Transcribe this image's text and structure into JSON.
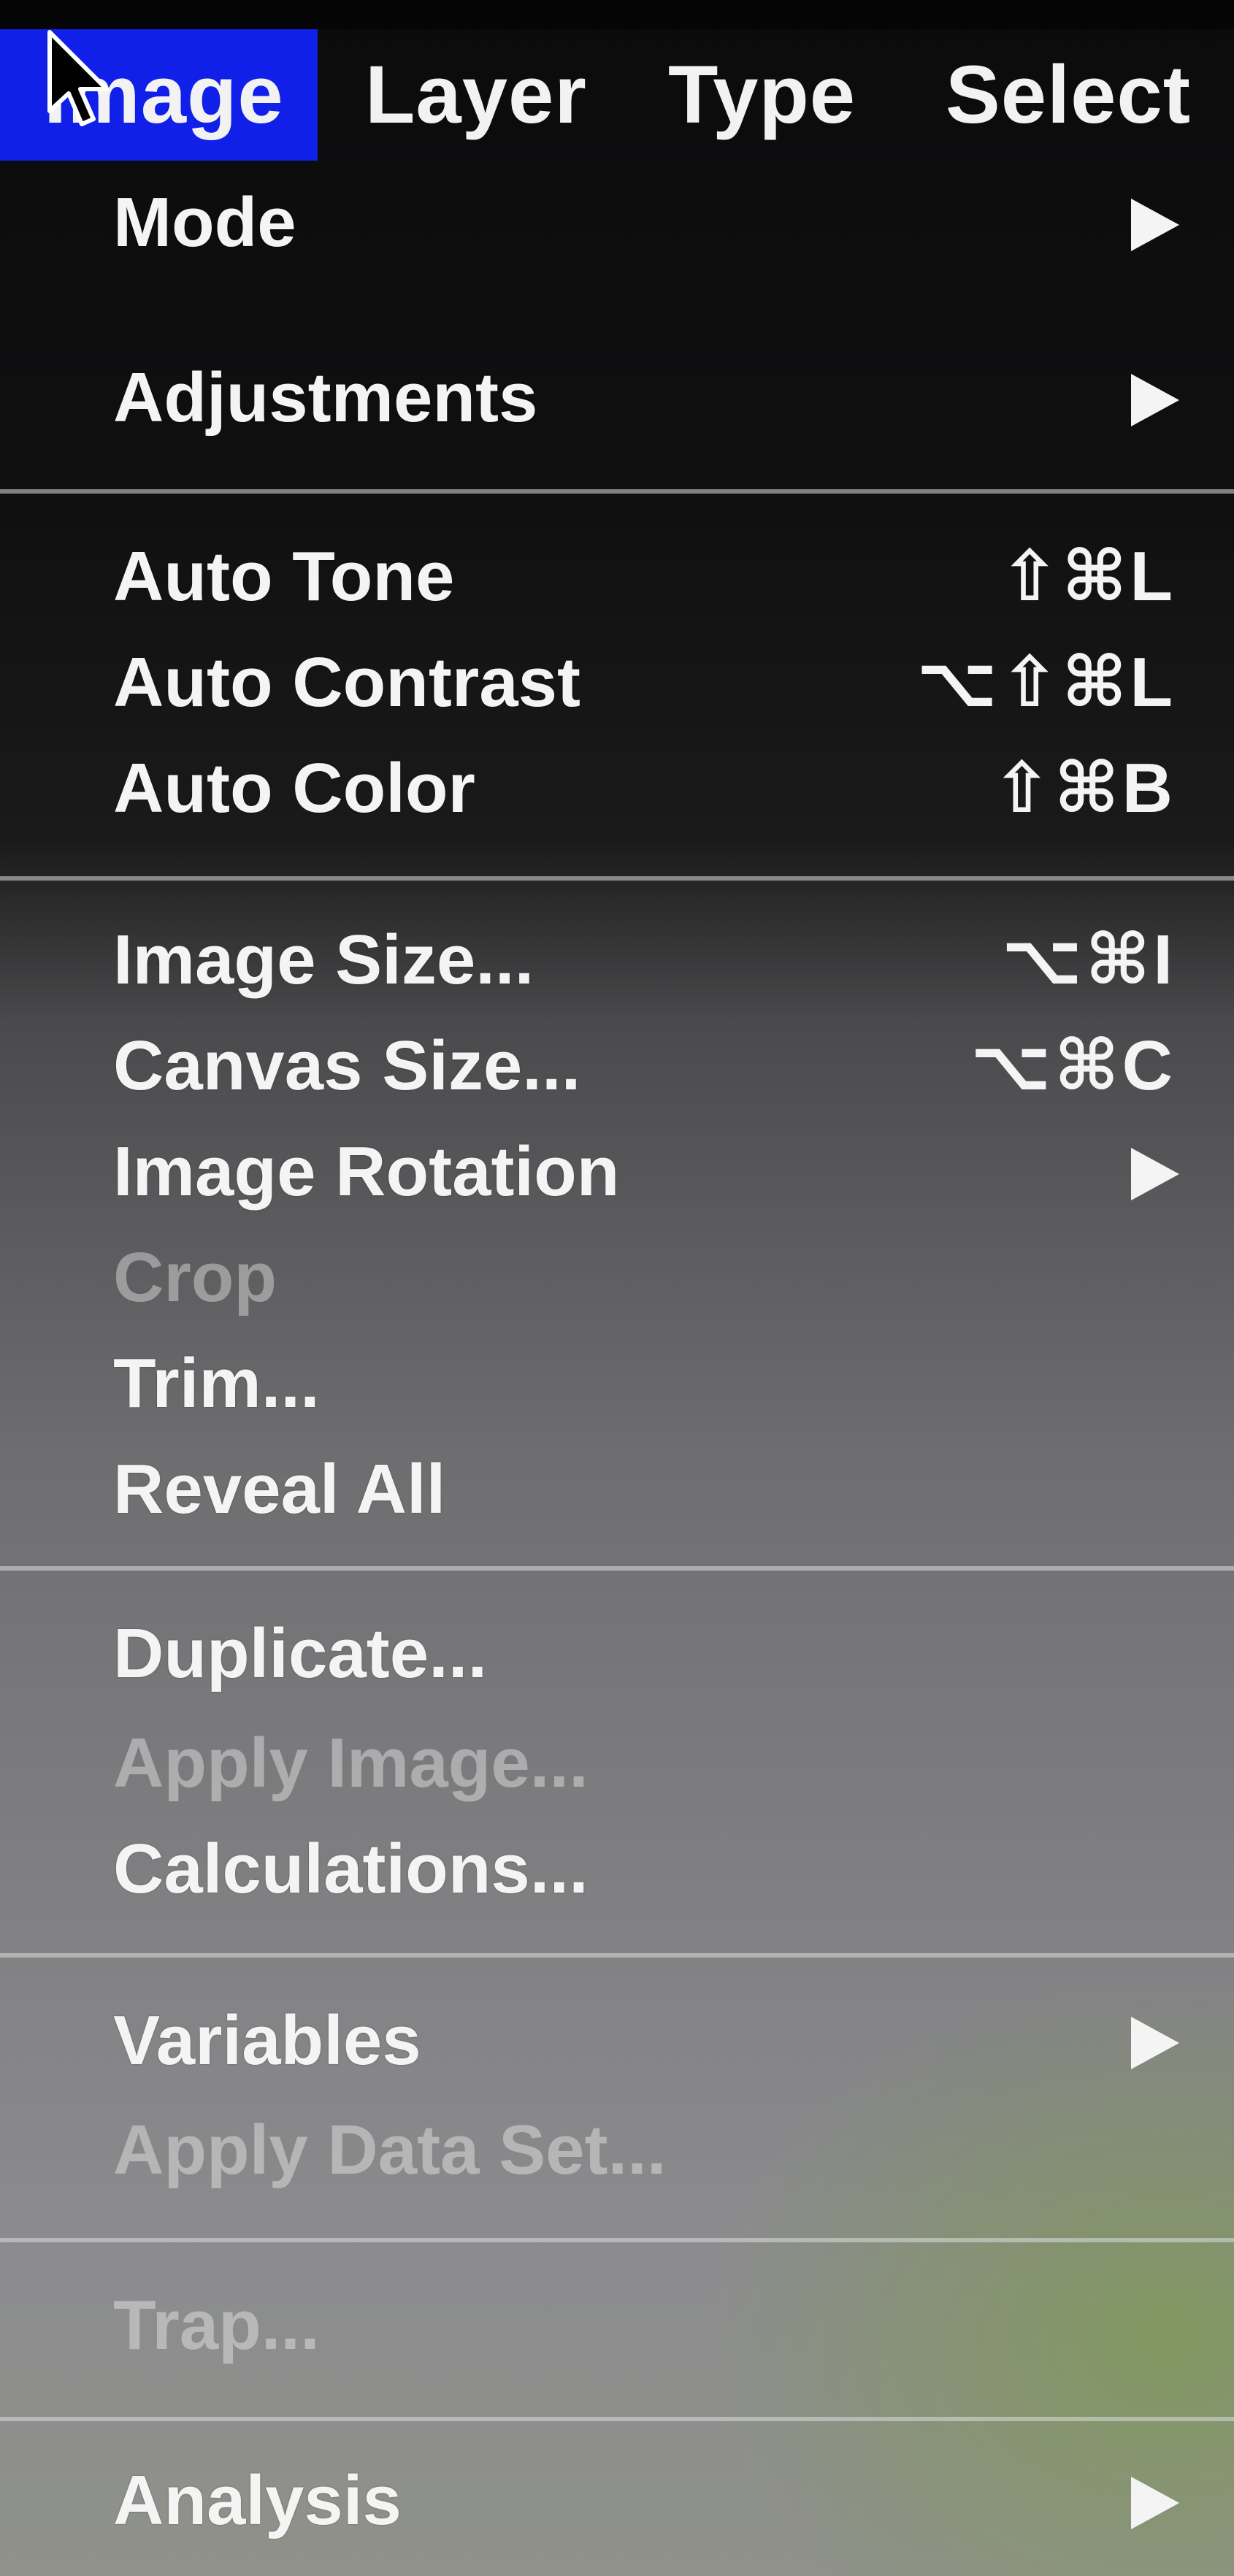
{
  "menubar": {
    "items": [
      {
        "label": "Image"
      },
      {
        "label": "Layer"
      },
      {
        "label": "Type"
      },
      {
        "label": "Select"
      }
    ]
  },
  "menu": {
    "items": [
      {
        "label": "Mode",
        "has_submenu": true
      },
      {
        "label": "Adjustments",
        "has_submenu": true
      },
      {
        "label": "Auto Tone",
        "shortcut": "⇧⌘L"
      },
      {
        "label": "Auto Contrast",
        "shortcut": "⌥⇧⌘L"
      },
      {
        "label": "Auto Color",
        "shortcut": "⇧⌘B"
      },
      {
        "label": "Image Size...",
        "shortcut": "⌥⌘I"
      },
      {
        "label": "Canvas Size...",
        "shortcut": "⌥⌘C"
      },
      {
        "label": "Image Rotation",
        "has_submenu": true
      },
      {
        "label": "Crop",
        "disabled": true
      },
      {
        "label": "Trim..."
      },
      {
        "label": "Reveal All"
      },
      {
        "label": "Duplicate..."
      },
      {
        "label": "Apply Image...",
        "disabled": true
      },
      {
        "label": "Calculations..."
      },
      {
        "label": "Variables",
        "has_submenu": true
      },
      {
        "label": "Apply Data Set...",
        "disabled": true
      },
      {
        "label": "Trap...",
        "disabled": true
      },
      {
        "label": "Analysis",
        "has_submenu": true
      }
    ]
  },
  "icons": {
    "cursor": "arrow-pointer-icon",
    "submenu": "chevron-right-icon"
  },
  "colors": {
    "menubar_highlight": "#1020e8",
    "text": "#f4f4f4",
    "disabled_text": "rgba(255,255,255,0.38)"
  }
}
